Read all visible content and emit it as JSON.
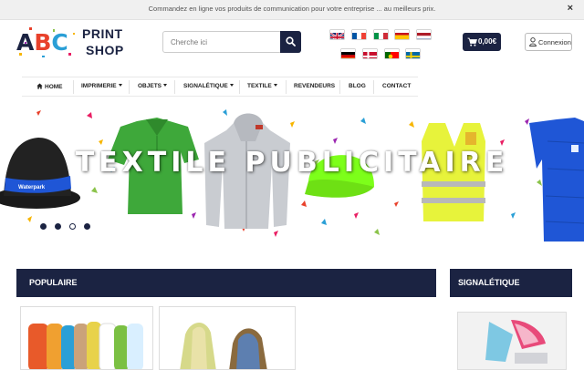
{
  "topbar": {
    "message": "Commandez en ligne vos produits de communication pour votre entreprise ... au meilleurs prix.",
    "close_label": "×"
  },
  "logo": {
    "letters": [
      "A",
      "B",
      "C"
    ],
    "letter_colors": [
      "#1b2342",
      "#e8412b",
      "#2a9fd6"
    ],
    "line1": "PRINT",
    "line2": "SHOP"
  },
  "search": {
    "placeholder": "Cherche ici",
    "value": ""
  },
  "flags": [
    "uk-flag",
    "france-flag",
    "italy-flag",
    "spain-flag",
    "netherlands-flag",
    "germany-flag",
    "denmark-flag",
    "portugal-flag",
    "sweden-flag"
  ],
  "cart": {
    "total": "0,00€"
  },
  "login": {
    "label": "Connexion"
  },
  "nav": {
    "items": [
      {
        "label": "HOME",
        "dropdown": false
      },
      {
        "label": "IMPRIMERIE",
        "dropdown": true
      },
      {
        "label": "OBJETS",
        "dropdown": true
      },
      {
        "label": "SIGNALÉTIQUE",
        "dropdown": true
      },
      {
        "label": "TEXTILE",
        "dropdown": true
      },
      {
        "label": "REVENDEURS",
        "dropdown": false
      },
      {
        "label": "BLOG",
        "dropdown": false
      },
      {
        "label": "CONTACT",
        "dropdown": false
      }
    ]
  },
  "banner": {
    "title": "TEXTILE PUBLICITAIRE",
    "hat_band": "Waterpark",
    "slides": 4,
    "active_slide": 3
  },
  "sections": {
    "popular": "POPULAIRE",
    "signage": "SIGNALÉTIQUE"
  },
  "colors": {
    "brand": "#1b2342",
    "green_polo": "#3ea83a",
    "grey_hoodie": "#c9ccd1",
    "lime_cap": "#7dff1a",
    "safety_vest": "#e7f33b",
    "blue_jacket": "#1f56d6"
  }
}
